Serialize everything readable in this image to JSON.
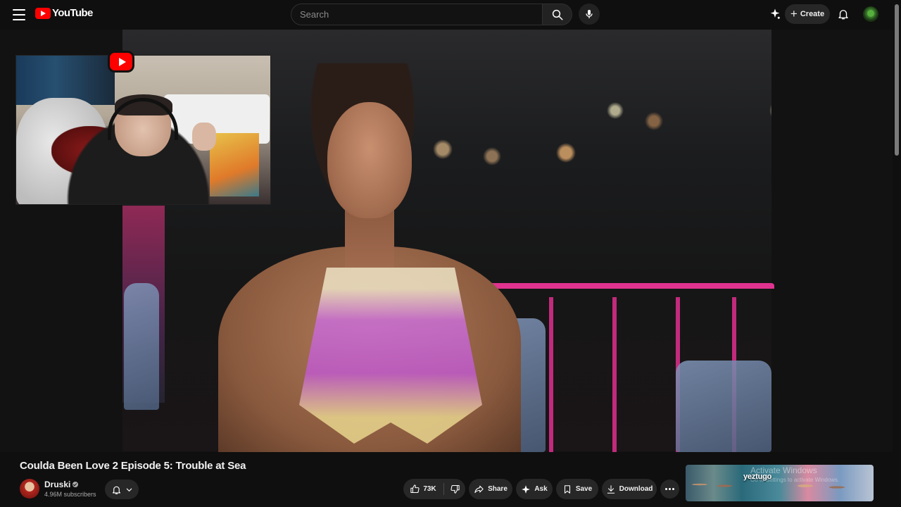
{
  "header": {
    "logo_text": "YouTube",
    "search_placeholder": "Search",
    "create_label": "Create"
  },
  "icons": {
    "menu": "hamburger-icon",
    "search": "search-icon",
    "mic": "microphone-icon",
    "sparkle": "sparkle-icon",
    "create": "plus-icon",
    "notifications": "bell-icon",
    "subscribe": "bell-icon",
    "like": "thumbs-up-icon",
    "dislike": "thumbs-down-icon",
    "share": "share-arrow-icon",
    "ask": "sparkle-icon",
    "save": "bookmark-icon",
    "download": "download-icon",
    "more": "more-horizontal-icon"
  },
  "video": {
    "title": "Coulda Been Love 2 Episode 5: Trouble at Sea"
  },
  "channel": {
    "name": "Druski",
    "subscribers": "4.96M subscribers"
  },
  "actions": {
    "like_count": "73K",
    "share_label": "Share",
    "ask_label": "Ask",
    "save_label": "Save",
    "download_label": "Download"
  },
  "suggested": {
    "brand_text": "yeztugo",
    "overlay_line1": "Activate Windows",
    "overlay_line2": "Go to Settings to activate Windows."
  },
  "colors": {
    "background": "#0f0f0f",
    "brand_red": "#ff0000",
    "chip": "#272727",
    "text_primary": "#f1f1f1",
    "text_secondary": "#aaaaaa"
  }
}
